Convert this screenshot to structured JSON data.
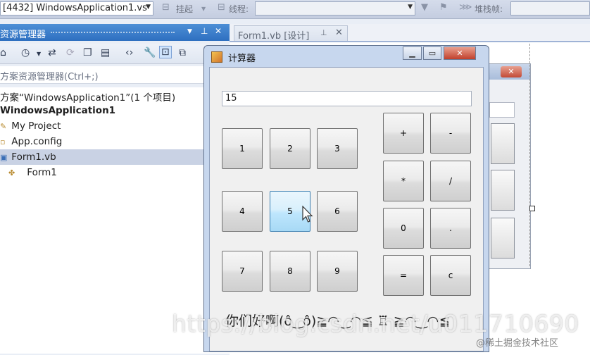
{
  "toolbar": {
    "process_combo": "[4432] WindowsApplication1.vs",
    "suspend_label": "挂起",
    "thread_label": "线程:",
    "stack_label": "堆栈帧:"
  },
  "solution_explorer": {
    "title": "资源管理器",
    "search_placeholder": "方案资源管理器(Ctrl+;)",
    "tree": [
      {
        "label": "方案“WindowsApplication1”(1 个项目)"
      },
      {
        "label": "WindowsApplication1"
      },
      {
        "label": "My Project"
      },
      {
        "label": "App.config"
      },
      {
        "label": "Form1.vb"
      },
      {
        "label": "Form1"
      }
    ]
  },
  "document_tab": {
    "label": "Form1.vb [设计]"
  },
  "calculator": {
    "title": "计算器",
    "display_value": "15",
    "keys": [
      "1",
      "2",
      "3",
      "4",
      "5",
      "6",
      "7",
      "8",
      "9",
      "+",
      "-",
      "*",
      "/",
      "0",
      ".",
      "=",
      "c"
    ],
    "hovered_key": "5",
    "footer_text": "你们好啊(ô‿ô)≧◠‿◠≦ ♖ ≧◠‿◠≦"
  },
  "watermark": {
    "url": "https://blog.csdn.net/u011710690",
    "brand": "@稀土掘金技术社区"
  }
}
